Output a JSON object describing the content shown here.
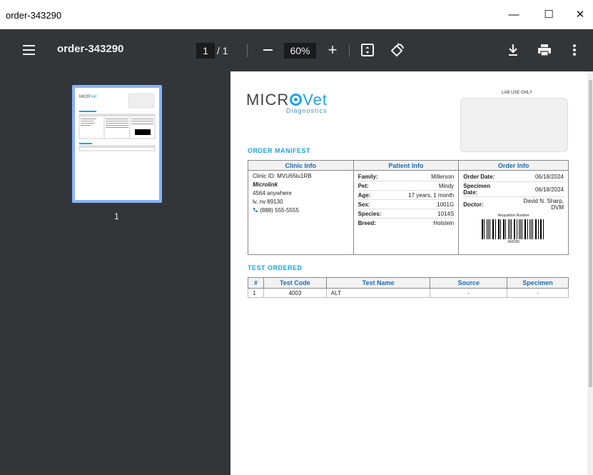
{
  "window": {
    "title": "order-343290",
    "min_glyph": "—",
    "max_glyph": "☐",
    "close_glyph": "✕"
  },
  "toolbar": {
    "doc_title": "order-343290",
    "page_current": "1",
    "page_total": "/ 1",
    "zoom": "60%",
    "zoom_in_glyph": "+"
  },
  "sidebar": {
    "page_label": "1"
  },
  "doc": {
    "logo_left": "MICR",
    "logo_right": "Vet",
    "logo_sub": "Diagnostics",
    "lab_use_label": "LAB USE ONLY",
    "manifest_title": "ORDER MANIFEST",
    "columns": [
      "Clinic Info",
      "Patient Info",
      "Order Info"
    ],
    "clinic": {
      "clinic_id": "Clinic ID: MVU65lu1RB",
      "name": "Microlink",
      "street": "4564 anywhere",
      "city": "lv, nv 89130",
      "phone": "(888) 555-5555"
    },
    "patient": [
      {
        "k": "Family:",
        "v": "Millerson"
      },
      {
        "k": "Pet:",
        "v": "Mindy"
      },
      {
        "k": "Age:",
        "v": "17 years, 1 month"
      },
      {
        "k": "Sex:",
        "v": "1001G"
      },
      {
        "k": "Species:",
        "v": "1014S"
      },
      {
        "k": "Breed:",
        "v": "Holstein"
      }
    ],
    "order": [
      {
        "k": "Order Date:",
        "v": "06/18/2024"
      },
      {
        "k": "Specimen Date:",
        "v": "06/18/2024"
      },
      {
        "k": "Doctor:",
        "v": "David N. Sharp, DVM"
      }
    ],
    "req_label": "Requisition Number",
    "req_number": "343290",
    "tests_title": "TEST ORDERED",
    "test_headers": [
      "#",
      "Test Code",
      "Test Name",
      "Source",
      "Specimen"
    ],
    "tests": [
      {
        "num": "1",
        "code": "4003",
        "name": "ALT",
        "source": "-",
        "specimen": "-"
      }
    ]
  },
  "colors": {
    "accent": "#1aa3e8",
    "toolbar_bg": "#323639",
    "viewer_bg": "#525659",
    "thumb_border": "#8ab4f8"
  }
}
